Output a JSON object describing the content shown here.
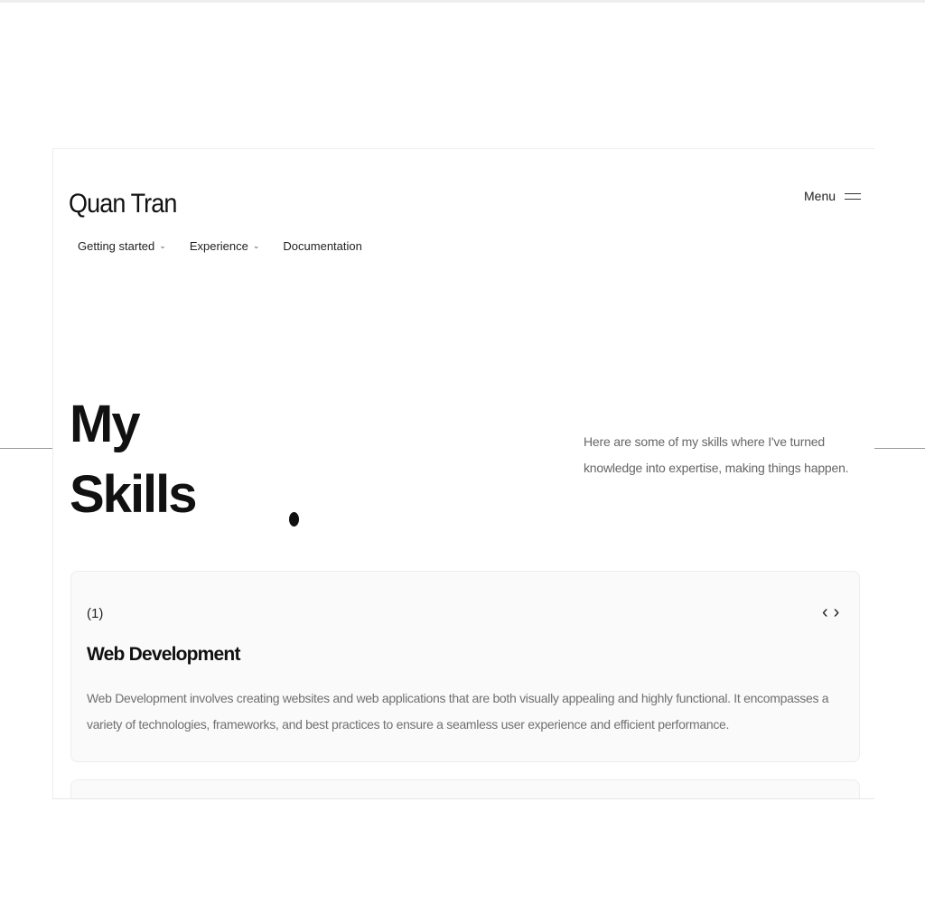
{
  "header": {
    "brand": "Quan Tran",
    "menu_label": "Menu"
  },
  "nav": {
    "items": [
      {
        "label": "Getting started",
        "has_dropdown": true,
        "icon": "chevron-down-icon"
      },
      {
        "label": "Experience",
        "has_dropdown": true,
        "icon": "chevron-down-icon"
      },
      {
        "label": "Documentation",
        "has_dropdown": false
      }
    ]
  },
  "hero": {
    "title_line1": "My",
    "title_line2": "Skills",
    "description": "Here are some of my skills where I've turned knowledge into expertise, making things happen."
  },
  "skills": [
    {
      "number": "(1)",
      "title": "Web Development",
      "text": "Web Development involves creating websites and web applications that are both visually appealing and highly functional. It encompasses a variety of technologies, frameworks, and best practices to ensure a seamless user experience and efficient performance.",
      "prev_glyph": "‹",
      "next_glyph": "›"
    }
  ],
  "colors": {
    "text": "#111111",
    "muted": "#666666",
    "card_bg": "#fafafa",
    "card_border": "#ededed"
  }
}
